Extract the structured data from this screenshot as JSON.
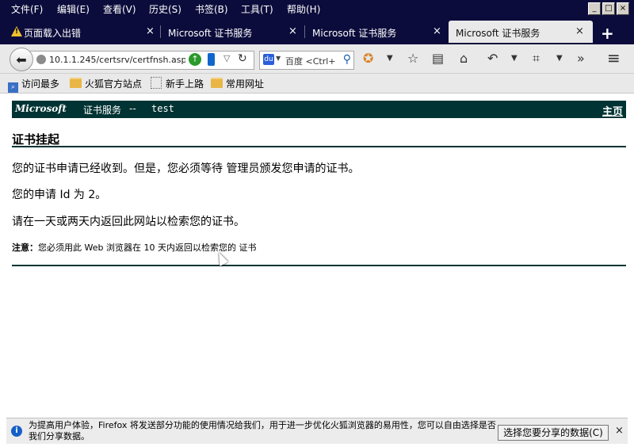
{
  "window": {
    "menus": [
      "文件(F)",
      "编辑(E)",
      "查看(V)",
      "历史(S)",
      "书签(B)",
      "工具(T)",
      "帮助(H)"
    ],
    "controls": {
      "minimize": "_",
      "restore": "□",
      "close": "×"
    }
  },
  "tabs": [
    {
      "label": "页面载入出错",
      "close": "×"
    },
    {
      "label": "Microsoft 证书服务",
      "close": "×"
    },
    {
      "label": "Microsoft 证书服务",
      "close": "×"
    },
    {
      "label": "Microsoft 证书服务",
      "close": "×"
    }
  ],
  "new_tab_label": "+",
  "nav": {
    "url": "10.1.1.245/certsrv/certfnsh.asp",
    "search_engine": "百度",
    "search_placeholder": "<Ctrl+K>"
  },
  "bookmarks": [
    "访问最多",
    "火狐官方站点",
    "新手上路",
    "常用网址"
  ],
  "page": {
    "brand": "Microsoft",
    "service": "证书服务",
    "separator": "--",
    "ca_name": "test",
    "home_link": "主页",
    "title": "证书挂起",
    "p1": "您的证书申请已经收到。但是，您必须等待 管理员颁发您申请的证书。",
    "p2": "您的申请 Id 为 2。",
    "p3": "请在一天或两天内返回此网站以检索您的证书。",
    "note_label": "注意：",
    "note_text": "您必须用此 Web 浏览器在 10 天内返回以检索您的 证书"
  },
  "notification": {
    "text": "为提高用户体验，Firefox 将发送部分功能的使用情况给我们，用于进一步优化火狐浏览器的易用性，您可以自由选择是否我们分享数据。",
    "button": "选择您要分享的数据(C)",
    "close": "×"
  },
  "colors": {
    "menubar_bg": "#0c0c3c",
    "header_bg": "#003333",
    "rule": "#003333"
  }
}
